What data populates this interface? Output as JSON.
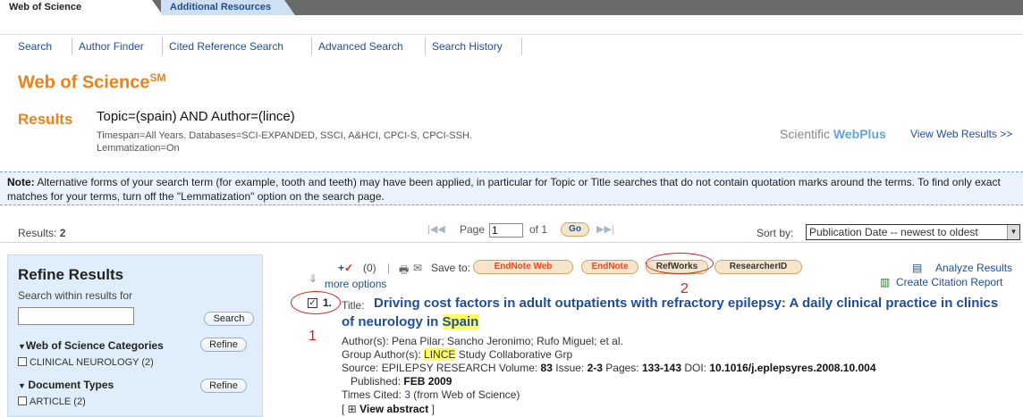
{
  "tabs": {
    "wos": "Web of Science",
    "additional": "Additional Resources"
  },
  "nav": [
    "Search",
    "Author Finder",
    "Cited Reference Search",
    "Advanced Search",
    "Search History"
  ],
  "brand": {
    "title": "Web of Science",
    "sup": "SM"
  },
  "results": {
    "label": "Results",
    "query": "Topic=(spain) AND Author=(lince)",
    "meta1": "Timespan=All Years. Databases=SCI-EXPANDED, SSCI, A&HCI, CPCI-S, CPCI-SSH.",
    "meta2": "Lemmatization=On",
    "webplus_a": "Scientific ",
    "webplus_b": "WebPlus",
    "webplus_link": "View Web Results >>"
  },
  "note": {
    "label": "Note:",
    "text": " Alternative forms of your search term (for example, tooth and teeth) may have been applied, in particular for Topic or Title searches that do not contain quotation marks around the terms. To find only exact matches for your terms, turn off the \"Lemmatization\" option on the search page."
  },
  "bar": {
    "results_label": "Results:",
    "results_count": "2",
    "page_label": "Page",
    "page_value": "1",
    "of_label": "of 1",
    "go": "Go",
    "sort_label": "Sort by:",
    "sort_value": "Publication Date -- newest to oldest"
  },
  "refine": {
    "title": "Refine Results",
    "sub": "Search within results for",
    "search_btn": "Search",
    "sect1": "Web of Science Categories",
    "refine_btn": "Refine",
    "item1": "CLINICAL NEUROLOGY (2)",
    "sect2": "Document Types",
    "item2": "ARTICLE (2)"
  },
  "toolbar": {
    "count": "(0)",
    "save_to": "Save to:",
    "endnote_web": "EndNote Web",
    "endnote": "EndNote",
    "refworks": "RefWorks",
    "researcherid": "ResearcherID",
    "more_options": "more options",
    "analyze": "Analyze Results",
    "citation": "Create Citation Report"
  },
  "annotations": {
    "one": "1",
    "two": "2"
  },
  "record": {
    "num": "1.",
    "title_label": "Title:",
    "title_a": "Driving cost factors in adult outpatients with refractory epilepsy: A daily clinical practice in clinics",
    "title_b": "of neurology in ",
    "title_hl": "Spain",
    "authors": "Author(s): Pena Pilar; Sancho Jeronimo; Rufo Miguel; et al.",
    "group_pre": "Group Author(s): ",
    "group_hl": "LINCE",
    "group_post": " Study Collaborative Grp",
    "source_pre": "Source: EPILEPSY RESEARCH  Volume: ",
    "volume": "83",
    "issue_lbl": "  Issue: ",
    "issue": "2-3",
    "pages_lbl": "  Pages: ",
    "pages": "133-143",
    "doi_lbl": "  DOI: ",
    "doi": "10.1016/j.eplepsyres.2008.10.004",
    "published_lbl": "Published: ",
    "published": "FEB 2009",
    "cited_lbl": "Times Cited: ",
    "cited": "3",
    "cited_post": " (from Web of Science)",
    "abstract": "View abstract"
  },
  "colors": {
    "accent": "#e8821e",
    "link": "#1f4e96",
    "annotation": "#d62020",
    "highlight": "#ffff66"
  }
}
